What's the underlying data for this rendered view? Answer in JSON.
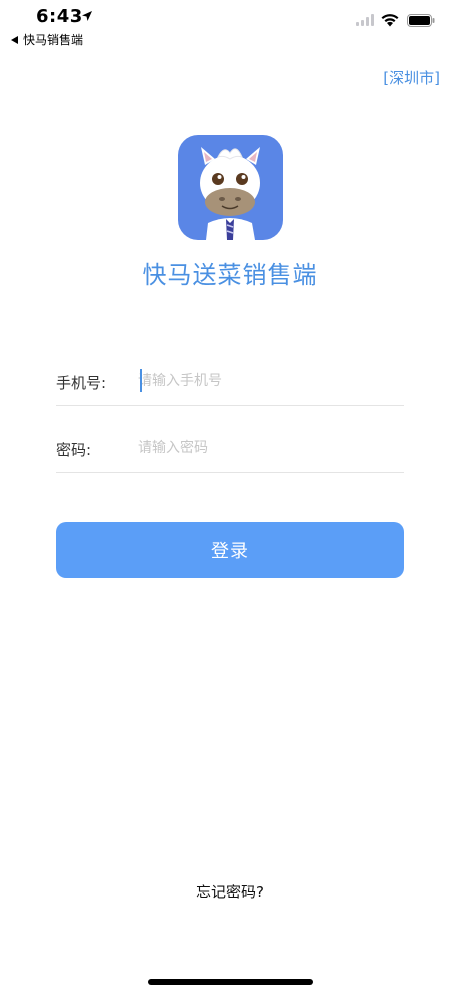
{
  "status_bar": {
    "time": "6:43",
    "back_app_label": "快马销售端"
  },
  "header": {
    "city_link": "[深圳市]"
  },
  "app": {
    "title": "快马送菜销售端",
    "brand_color": "#5a86e6",
    "accent_color": "#4a90e2"
  },
  "form": {
    "phone": {
      "label": "手机号:",
      "placeholder": "请输入手机号",
      "value": ""
    },
    "password": {
      "label": "密码:",
      "placeholder": "请输入密码",
      "value": ""
    },
    "login_label": "登录",
    "login_color": "#5b9ef7"
  },
  "footer": {
    "forgot_label": "忘记密码?"
  },
  "icons": [
    "location-arrow-icon",
    "back-arrow-icon",
    "cellular-signal-icon",
    "wifi-icon",
    "battery-icon",
    "horse-mascot-logo"
  ]
}
